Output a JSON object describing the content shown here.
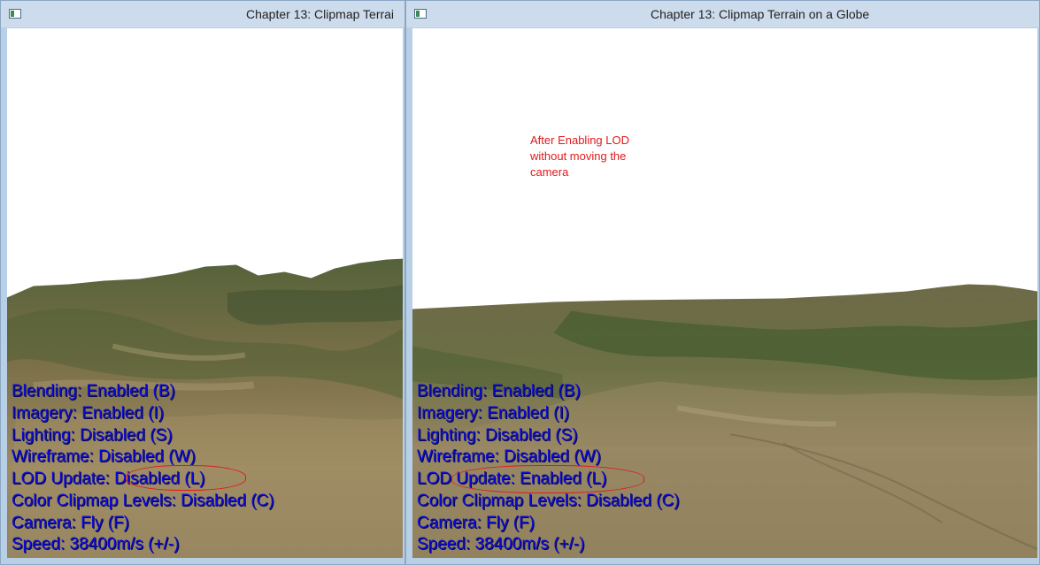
{
  "windows": [
    {
      "title": "Chapter 13:  Clipmap Terrai",
      "hud": [
        "Blending: Enabled (B)",
        "Imagery: Enabled (I)",
        "Lighting: Disabled (S)",
        "Wireframe: Disabled (W)",
        "LOD Update: Disabled (L)",
        "Color Clipmap Levels: Disabled (C)",
        "Camera: Fly (F)",
        "Speed: 38400m/s (+/-)"
      ]
    },
    {
      "title": "Chapter 13:  Clipmap Terrain on a Globe",
      "hud": [
        "Blending: Enabled (B)",
        "Imagery: Enabled (I)",
        "Lighting: Disabled (S)",
        "Wireframe: Disabled (W)",
        "LOD Update: Enabled (L)",
        "Color Clipmap Levels: Disabled (C)",
        "Camera: Fly (F)",
        "Speed: 38400m/s (+/-)"
      ],
      "annotation": [
        "After Enabling LOD",
        "without moving the",
        "camera"
      ]
    }
  ],
  "colors": {
    "hud_text": "#0c0cd6",
    "annotation": "#e0191d",
    "sky": "#ffffff"
  }
}
